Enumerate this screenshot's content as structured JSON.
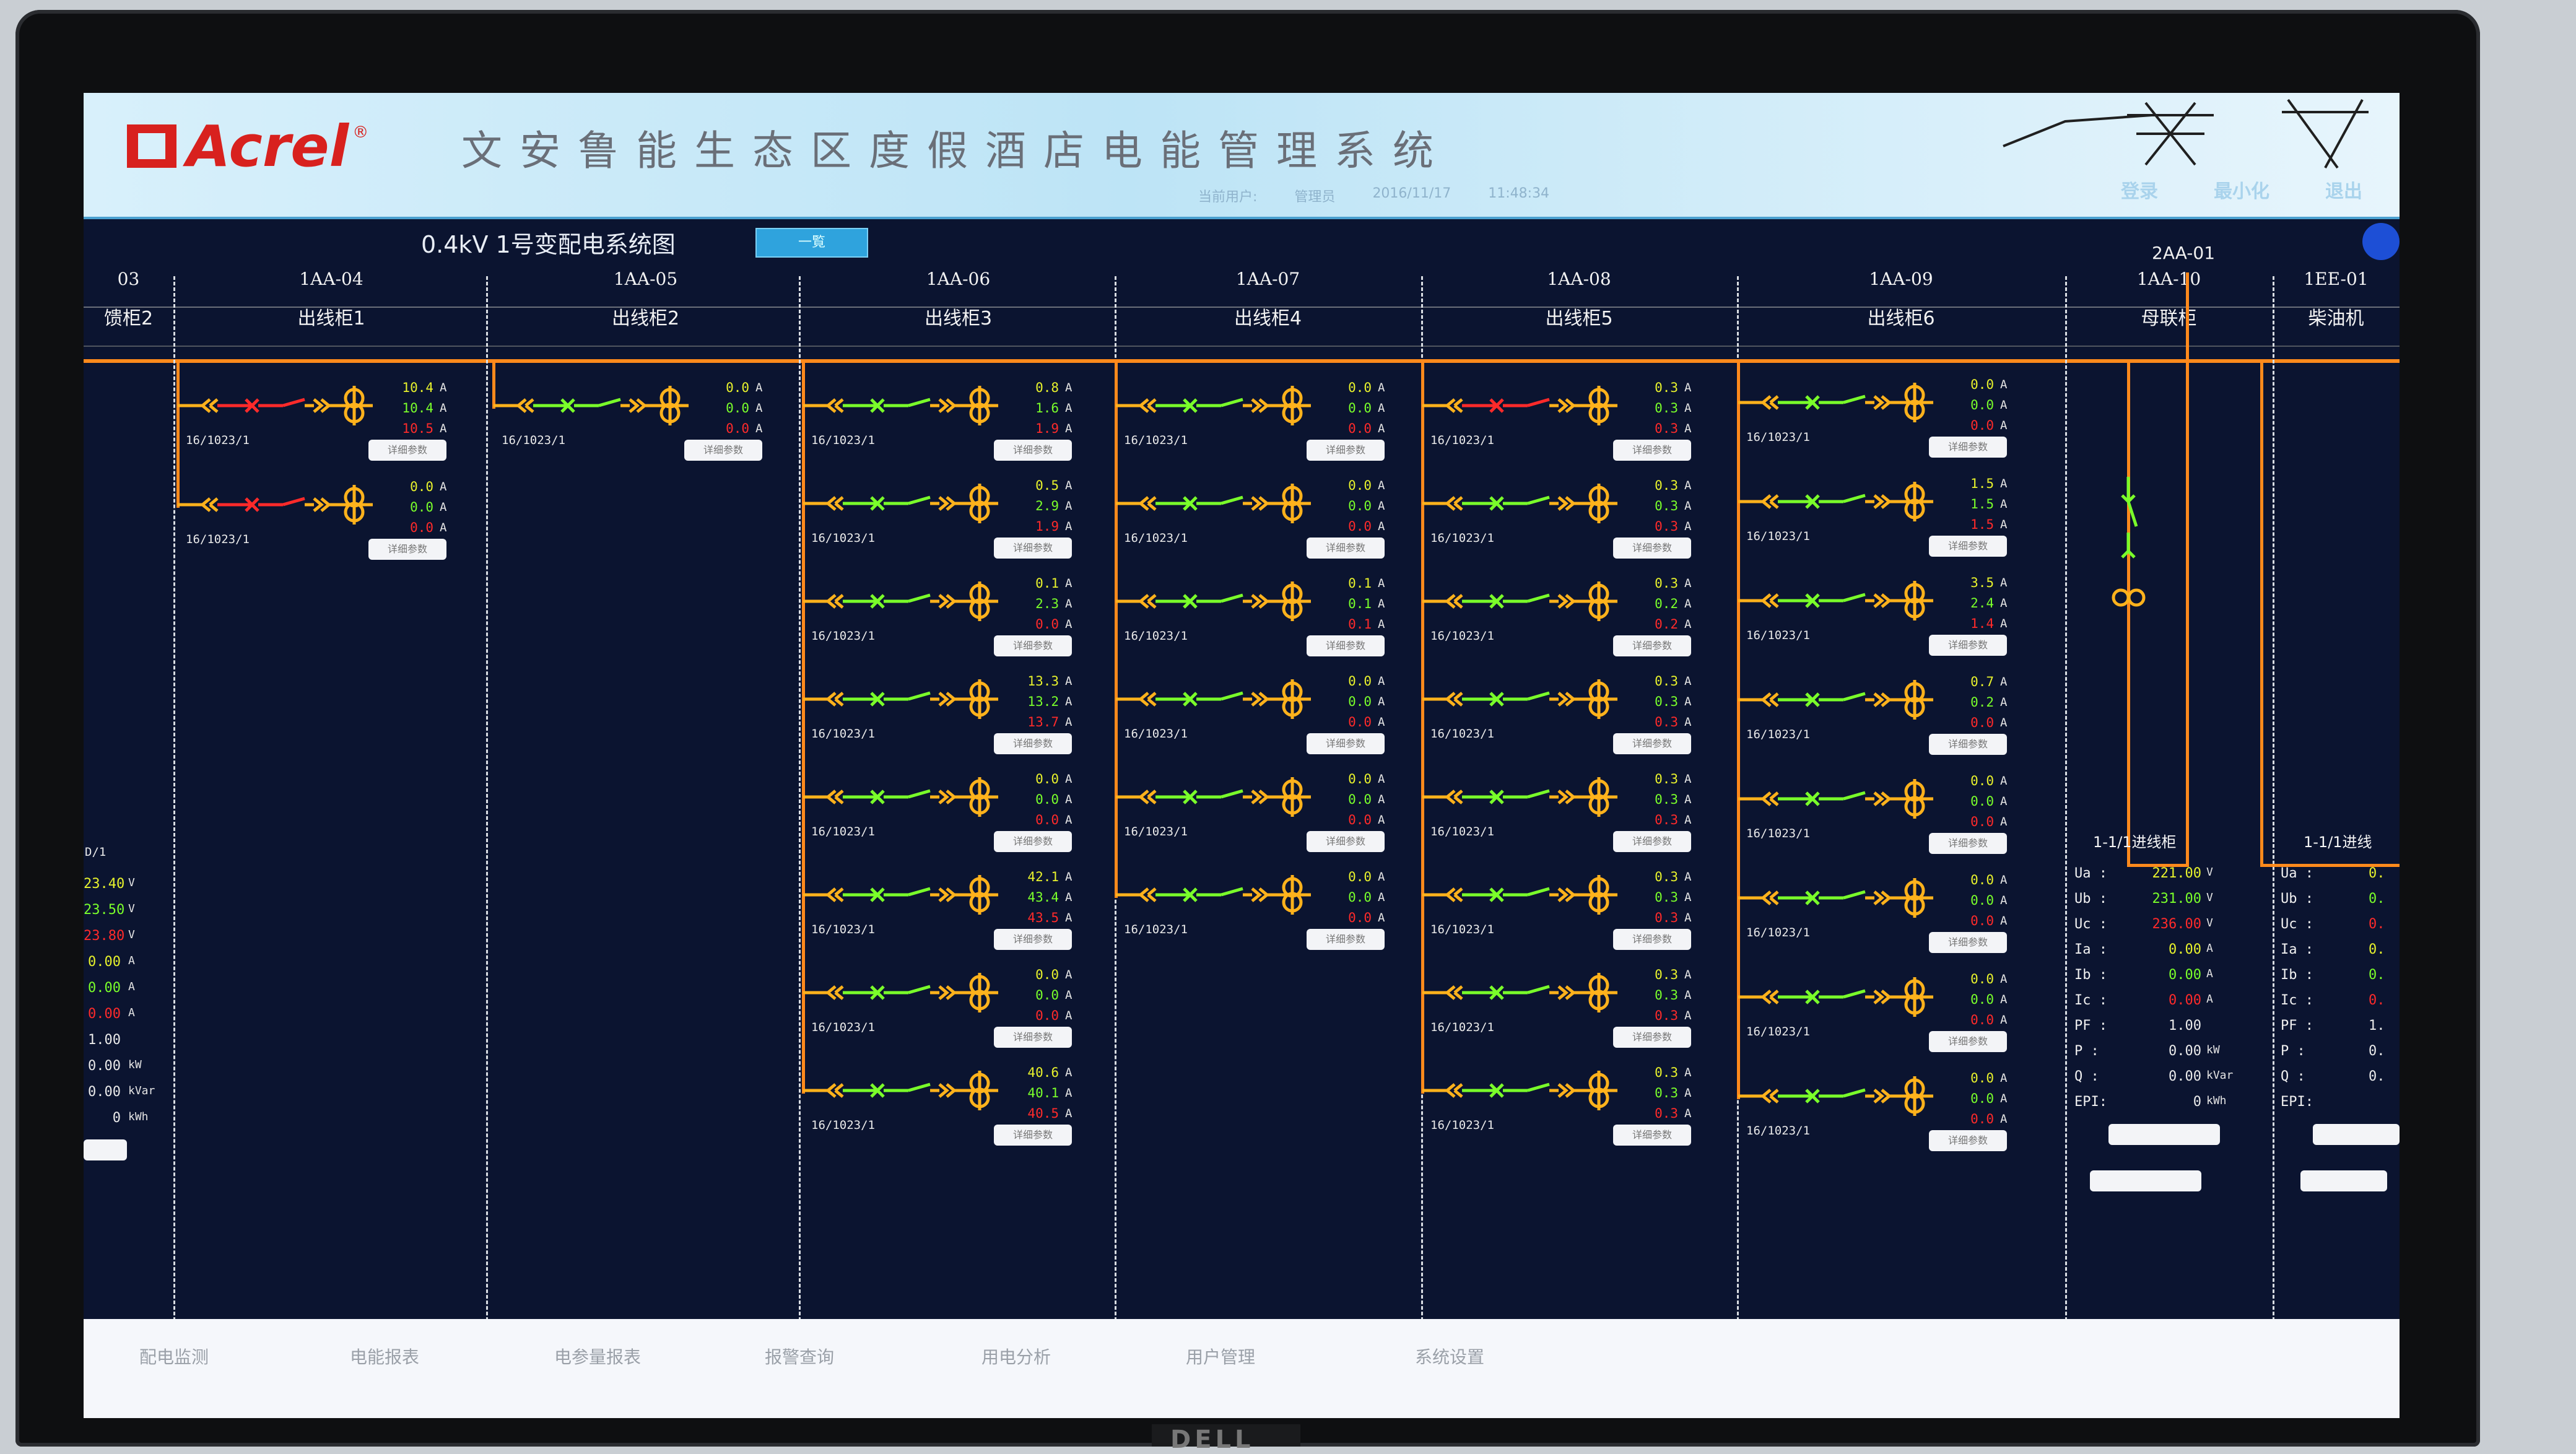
{
  "header": {
    "brand": "Acrel",
    "system_title": "文安鲁能生态区度假酒店电能管理系统",
    "user_info": [
      "当前用户:",
      "管理员",
      "2016/11/17",
      "11:48:34"
    ],
    "right_buttons": [
      "登录",
      "最小化",
      "退出"
    ]
  },
  "subbar": {
    "diagram_title": "0.4kV 1号变配电系统图",
    "back_button": "一覧",
    "corner_label": "2AA-01"
  },
  "columns": [
    {
      "code": "03",
      "name": "馈柜2"
    },
    {
      "code": "1AA-04",
      "name": "出线柜1"
    },
    {
      "code": "1AA-05",
      "name": "出线柜2"
    },
    {
      "code": "1AA-06",
      "name": "出线柜3"
    },
    {
      "code": "1AA-07",
      "name": "出线柜4"
    },
    {
      "code": "1AA-08",
      "name": "出线柜5"
    },
    {
      "code": "1AA-09",
      "name": "出线柜6"
    },
    {
      "code": "1AA-10",
      "name": "母联柜"
    },
    {
      "code": "1EE-01",
      "name": "柴油机"
    }
  ],
  "ratio_label": "16/1023/1",
  "detail_label": "详细参数",
  "unit_a": "A",
  "panels": {
    "p04": [
      {
        "v": [
          "10.4",
          "10.4",
          "10.5"
        ],
        "state": "red"
      },
      {
        "v": [
          "0.0",
          "0.0",
          "0.0"
        ],
        "state": "red"
      }
    ],
    "p05": [
      {
        "v": [
          "0.0",
          "0.0",
          "0.0"
        ],
        "state": "green"
      }
    ],
    "p06": [
      {
        "v": [
          "0.8",
          "1.6",
          "1.9"
        ],
        "state": "green"
      },
      {
        "v": [
          "0.5",
          "2.9",
          "1.9"
        ],
        "state": "green"
      },
      {
        "v": [
          "0.1",
          "2.3",
          "0.0"
        ],
        "state": "green"
      },
      {
        "v": [
          "13.3",
          "13.2",
          "13.7"
        ],
        "state": "green"
      },
      {
        "v": [
          "0.0",
          "0.0",
          "0.0"
        ],
        "state": "green"
      },
      {
        "v": [
          "42.1",
          "43.4",
          "43.5"
        ],
        "state": "green"
      },
      {
        "v": [
          "0.0",
          "0.0",
          "0.0"
        ],
        "state": "green"
      },
      {
        "v": [
          "40.6",
          "40.1",
          "40.5"
        ],
        "state": "green"
      }
    ],
    "p07": [
      {
        "v": [
          "0.0",
          "0.0",
          "0.0"
        ],
        "state": "green"
      },
      {
        "v": [
          "0.0",
          "0.0",
          "0.0"
        ],
        "state": "green"
      },
      {
        "v": [
          "0.1",
          "0.1",
          "0.1"
        ],
        "state": "green"
      },
      {
        "v": [
          "0.0",
          "0.0",
          "0.0"
        ],
        "state": "green"
      },
      {
        "v": [
          "0.0",
          "0.0",
          "0.0"
        ],
        "state": "green"
      },
      {
        "v": [
          "0.0",
          "0.0",
          "0.0"
        ],
        "state": "green"
      }
    ],
    "p08": [
      {
        "v": [
          "0.3",
          "0.3",
          "0.3"
        ],
        "state": "red"
      },
      {
        "v": [
          "0.3",
          "0.3",
          "0.3"
        ],
        "state": "green"
      },
      {
        "v": [
          "0.3",
          "0.2",
          "0.2"
        ],
        "state": "green"
      },
      {
        "v": [
          "0.3",
          "0.3",
          "0.3"
        ],
        "state": "green"
      },
      {
        "v": [
          "0.3",
          "0.3",
          "0.3"
        ],
        "state": "green"
      },
      {
        "v": [
          "0.3",
          "0.3",
          "0.3"
        ],
        "state": "green"
      },
      {
        "v": [
          "0.3",
          "0.3",
          "0.3"
        ],
        "state": "green"
      },
      {
        "v": [
          "0.3",
          "0.3",
          "0.3"
        ],
        "state": "green"
      }
    ],
    "p09": [
      {
        "v": [
          "0.0",
          "0.0",
          "0.0"
        ],
        "state": "green"
      },
      {
        "v": [
          "1.5",
          "1.5",
          "1.5"
        ],
        "state": "green"
      },
      {
        "v": [
          "3.5",
          "2.4",
          "1.4"
        ],
        "state": "green"
      },
      {
        "v": [
          "0.7",
          "0.2",
          "0.0"
        ],
        "state": "green"
      },
      {
        "v": [
          "0.0",
          "0.0",
          "0.0"
        ],
        "state": "green"
      },
      {
        "v": [
          "0.0",
          "0.0",
          "0.0"
        ],
        "state": "green"
      },
      {
        "v": [
          "0.0",
          "0.0",
          "0.0"
        ],
        "state": "green"
      },
      {
        "v": [
          "0.0",
          "0.0",
          "0.0"
        ],
        "state": "green"
      }
    ]
  },
  "left_partial": {
    "ratio": "D/1",
    "values": [
      "23.40",
      "23.50",
      "23.80",
      "0.00",
      "0.00",
      "0.00",
      "1.00",
      "0.00",
      "0.00",
      "0"
    ],
    "units": [
      "V",
      "V",
      "V",
      "A",
      "A",
      "A",
      "",
      "kW",
      "kVar",
      "kWh"
    ]
  },
  "incomer_1": {
    "title": "1-1/1进线柜",
    "rows": [
      {
        "label": "Ua :",
        "value": "221.00",
        "unit": "V"
      },
      {
        "label": "Ub :",
        "value": "231.00",
        "unit": "V"
      },
      {
        "label": "Uc :",
        "value": "236.00",
        "unit": "V"
      },
      {
        "label": "Ia :",
        "value": "0.00",
        "unit": "A"
      },
      {
        "label": "Ib :",
        "value": "0.00",
        "unit": "A"
      },
      {
        "label": "Ic :",
        "value": "0.00",
        "unit": "A"
      },
      {
        "label": "PF :",
        "value": "1.00",
        "unit": ""
      },
      {
        "label": "P :",
        "value": "0.00",
        "unit": "kW"
      },
      {
        "label": "Q :",
        "value": "0.00",
        "unit": "kVar"
      },
      {
        "label": "EPI:",
        "value": "0",
        "unit": "kWh"
      }
    ]
  },
  "incomer_2": {
    "title": "1-1/1进线",
    "labels": [
      "Ua :",
      "Ub :",
      "Uc :",
      "Ia :",
      "Ib :",
      "Ic :",
      "PF :",
      "P :",
      "Q :",
      "EPI:"
    ],
    "values": [
      "0.",
      "0.",
      "0.",
      "0.",
      "0.",
      "0.",
      "1.",
      "0.",
      "0.",
      ""
    ]
  },
  "bottom_tabs": [
    "配电监测",
    "电能报表",
    "电参量报表",
    "报警查询",
    "用电分析",
    "用户管理",
    "系统设置"
  ],
  "monitor_brand": "DELL",
  "colors": {
    "bus": "#ff8a1c",
    "breaker_closed": "#7aff2a",
    "breaker_open": "#ff2a2a",
    "switch": "#ffb21c"
  }
}
